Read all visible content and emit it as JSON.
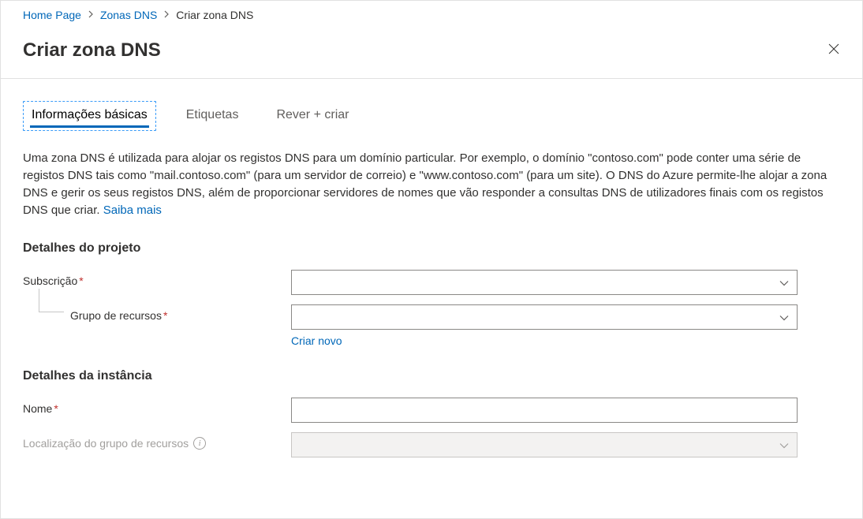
{
  "breadcrumb": {
    "home": "Home Page",
    "zones": "Zonas DNS",
    "current": "Criar zona DNS"
  },
  "page_title": "Criar zona DNS",
  "tabs": {
    "basics": "Informações básicas",
    "tags": "Etiquetas",
    "review": "Rever + criar"
  },
  "description_text": "Uma zona DNS é utilizada para alojar os registos DNS para um domínio particular. Por exemplo, o domínio \"contoso.com\" pode conter uma série de registos DNS tais como \"mail.contoso.com\" (para um servidor de correio) e \"www.contoso.com\" (para um site). O DNS do Azure permite-lhe alojar a zona DNS e gerir os seus registos DNS, além de proporcionar servidores de nomes que vão responder a consultas DNS de utilizadores finais com os registos DNS que criar. ",
  "learn_more": "Saiba mais",
  "sections": {
    "project": {
      "title": "Detalhes do projeto",
      "subscription_label": "Subscrição",
      "resource_group_label": "Grupo de recursos",
      "create_new": "Criar novo",
      "subscription_value": "",
      "resource_group_value": ""
    },
    "instance": {
      "title": "Detalhes da instância",
      "name_label": "Nome",
      "location_label": "Localização do grupo de recursos",
      "name_value": "",
      "location_value": ""
    }
  }
}
